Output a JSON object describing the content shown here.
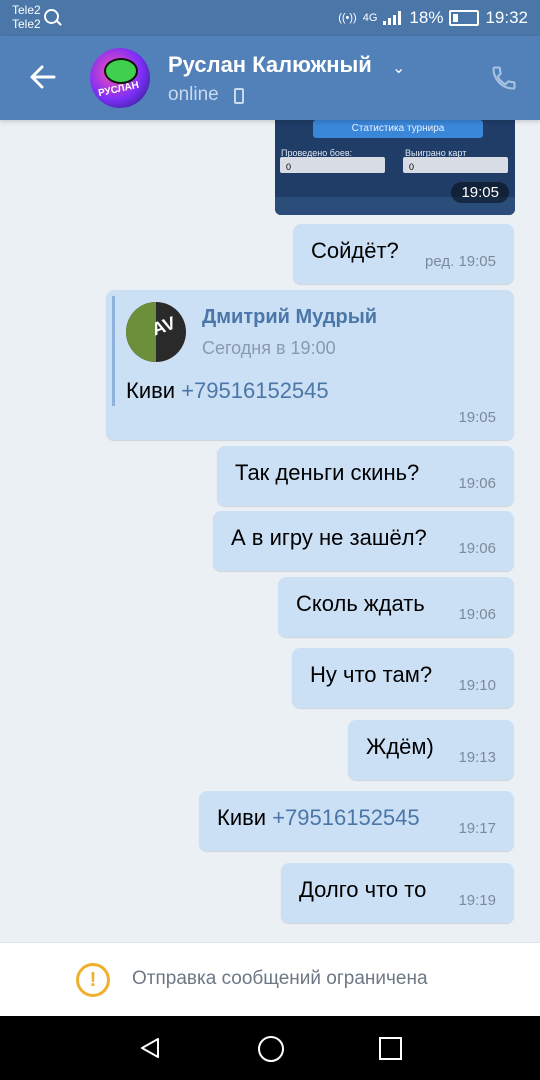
{
  "statusbar": {
    "carrier1": "Tele2",
    "carrier2": "Tele2",
    "network": "4G",
    "battery": "18%",
    "time": "19:32"
  },
  "header": {
    "contact_name": "Руслан Калюжный",
    "status": "online",
    "avatar_text": "РУСЛАН"
  },
  "attachment": {
    "banner": "Статистика турнира",
    "label_left": "Проведено боев:",
    "label_right": "Выиграно карт",
    "value_left": "0",
    "value_right": "0",
    "time": "19:05"
  },
  "messages": [
    {
      "text": "Сойдёт?",
      "time": "ред. 19:05"
    },
    {
      "forwarded": true,
      "author": "Дмитрий Мудрый",
      "date": "Сегодня в 19:00",
      "prefix": "Киви ",
      "link": "+79516152545",
      "time": "19:05"
    },
    {
      "text": "Так деньги скинь?",
      "time": "19:06"
    },
    {
      "text": "А в игру не зашёл?",
      "time": "19:06"
    },
    {
      "text": "Сколь ждать",
      "time": "19:06"
    },
    {
      "text": "Ну что там?",
      "time": "19:10"
    },
    {
      "text": "Ждём)",
      "time": "19:13"
    },
    {
      "prefix": "Киви ",
      "link": "+79516152545",
      "time": "19:17"
    },
    {
      "text": "Долго что то",
      "time": "19:19"
    }
  ],
  "restriction": {
    "text": "Отправка сообщений ограничена"
  },
  "colors": {
    "header": "#5181b8",
    "statusbar": "#4a76a8",
    "bubble": "#cce0f5",
    "chat_bg": "#ebf0f5",
    "link": "#4a76a8",
    "warning": "#f0b02d"
  }
}
